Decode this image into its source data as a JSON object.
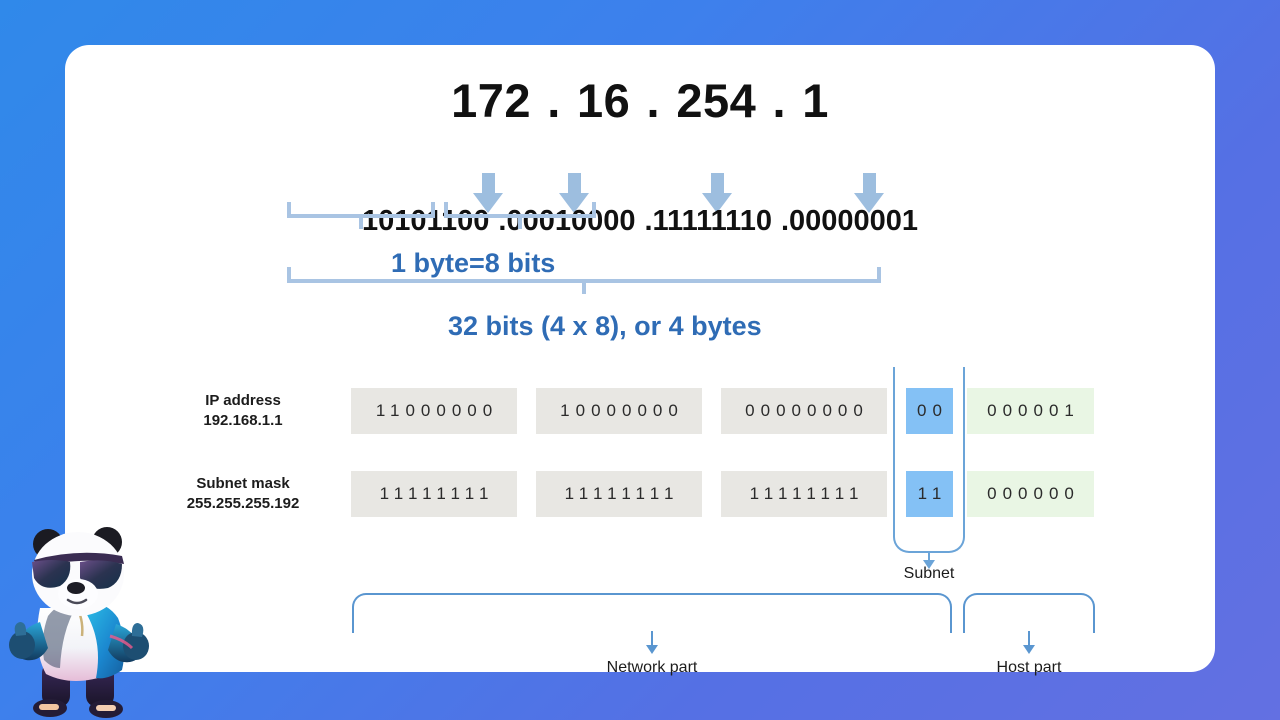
{
  "background": {
    "from": "#3089ea",
    "to": "#6370e2"
  },
  "card": {
    "bg": "#ffffff"
  },
  "decimal_ip": {
    "octets": [
      "172",
      "16",
      "254",
      "1"
    ],
    "separator": "."
  },
  "binary_ip": {
    "octets": [
      "10101100",
      "00010000",
      "11111110",
      "00000001"
    ],
    "separator": "."
  },
  "arrows": {
    "icon": "arrow-down-icon",
    "count": 4,
    "color": "#9dbedf"
  },
  "byte_bracket": {
    "label": "1 byte=8 bits",
    "color": "#a9c4e3",
    "text_color": "#2f6cb5"
  },
  "total_bracket": {
    "label": "32 bits (4 x 8), or 4 bytes",
    "color": "#a9c4e3",
    "text_color": "#2f6cb5"
  },
  "table": {
    "rows": [
      {
        "name": "ip-address",
        "label_line1": "IP address",
        "label_line2": "192.168.1.1",
        "cells": [
          {
            "group": "network",
            "bits": "11000000",
            "style": "gray"
          },
          {
            "group": "network",
            "bits": "10000000",
            "style": "gray"
          },
          {
            "group": "network",
            "bits": "00000000",
            "style": "gray"
          },
          {
            "group": "subnet",
            "bits": "00",
            "style": "blue"
          },
          {
            "group": "host",
            "bits": "000001",
            "style": "green"
          }
        ]
      },
      {
        "name": "subnet-mask",
        "label_line1": "Subnet mask",
        "label_line2": "255.255.255.192",
        "cells": [
          {
            "group": "network",
            "bits": "11111111",
            "style": "gray"
          },
          {
            "group": "network",
            "bits": "11111111",
            "style": "gray"
          },
          {
            "group": "network",
            "bits": "11111111",
            "style": "gray"
          },
          {
            "group": "subnet",
            "bits": "11",
            "style": "blue"
          },
          {
            "group": "host",
            "bits": "000000",
            "style": "green"
          }
        ]
      }
    ],
    "colors": {
      "gray": "#e8e7e3",
      "blue": "#84c1f5",
      "green": "#e9f6e4",
      "outline": "#6ba4d8"
    }
  },
  "subnet_callout": {
    "label": "Subnet",
    "color": "#6ba4d8"
  },
  "bottom_braces": {
    "color": "#5a96d0",
    "items": [
      {
        "name": "network-part",
        "label": "Network part"
      },
      {
        "name": "host-part",
        "label": "Host part"
      }
    ]
  },
  "mascot": {
    "name": "panda-mascot",
    "description": "panda with sunglasses giving thumbs up"
  }
}
